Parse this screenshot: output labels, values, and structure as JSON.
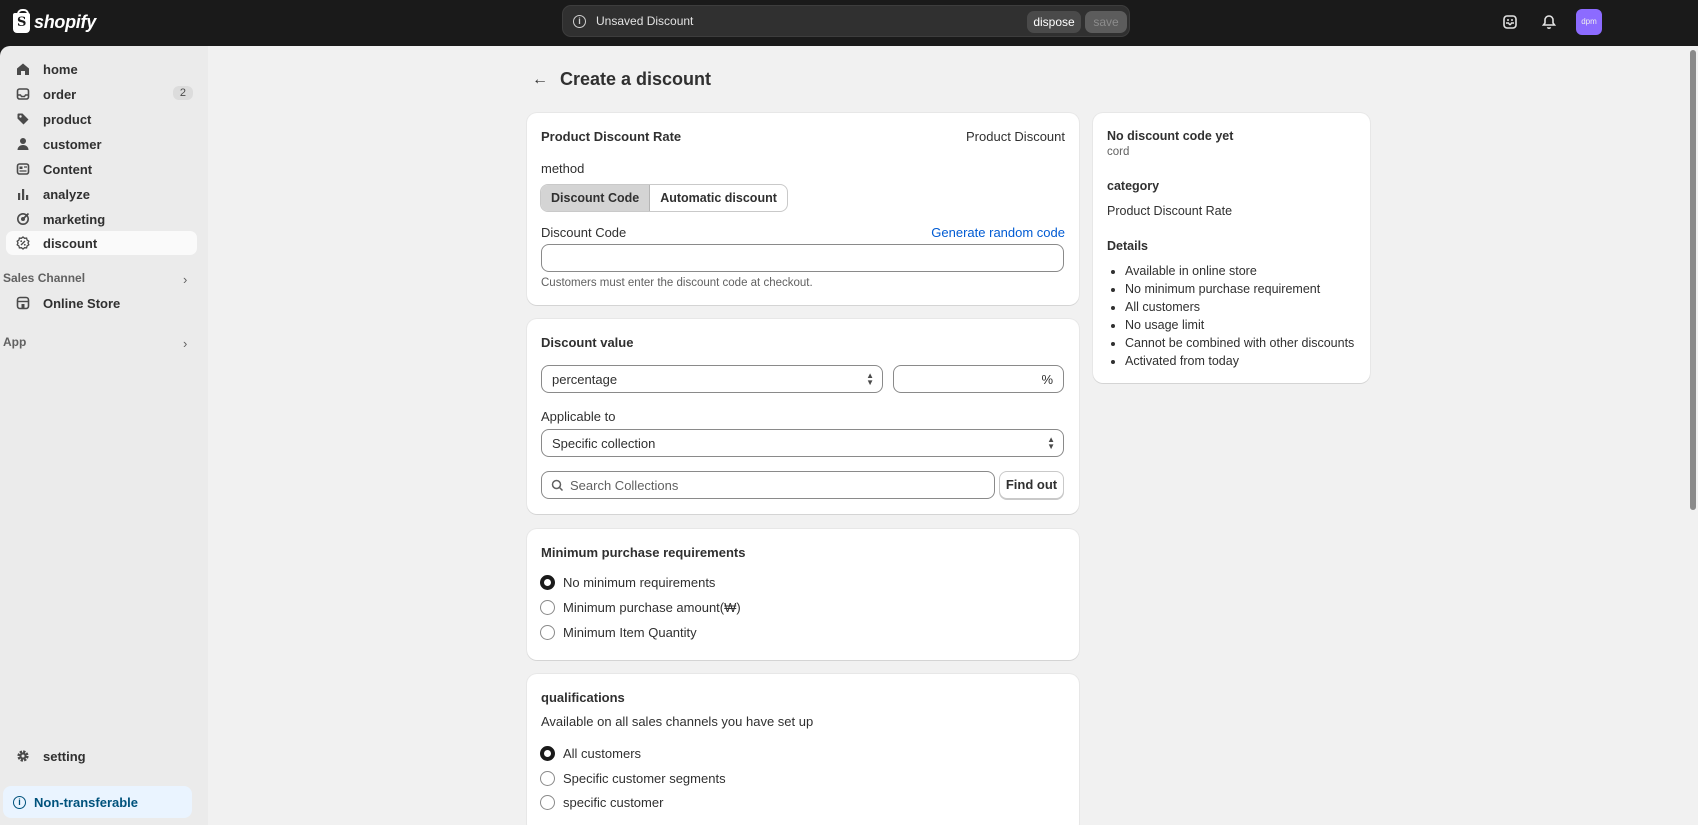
{
  "app": {
    "brand": "shopify"
  },
  "topbar": {
    "unsaved_label": "Unsaved Discount",
    "dispose_label": "dispose",
    "save_label": "save",
    "avatar_initials": "dpm"
  },
  "sidebar": {
    "items": [
      {
        "label": "home",
        "icon": "home-icon"
      },
      {
        "label": "order",
        "icon": "inbox-icon",
        "badge": "2"
      },
      {
        "label": "product",
        "icon": "tag-icon"
      },
      {
        "label": "customer",
        "icon": "person-icon"
      },
      {
        "label": "Content",
        "icon": "content-icon"
      },
      {
        "label": "analyze",
        "icon": "chart-icon"
      },
      {
        "label": "marketing",
        "icon": "target-icon"
      },
      {
        "label": "discount",
        "icon": "discount-icon"
      }
    ],
    "sales_channel_label": "Sales Channel",
    "online_store_label": "Online Store",
    "app_label": "App",
    "setting_label": "setting",
    "non_transferable_label": "Non-transferable"
  },
  "page": {
    "title": "Create a discount"
  },
  "card_code": {
    "title": "Product Discount Rate",
    "type_label": "Product Discount",
    "method_label": "method",
    "method_options": [
      "Discount Code",
      "Automatic discount"
    ],
    "method_selected": "Discount Code",
    "code_label": "Discount Code",
    "generate_link": "Generate random code",
    "code_value": "",
    "help_text": "Customers must enter the discount code at checkout."
  },
  "card_value": {
    "title": "Discount value",
    "type_select": "percentage",
    "amount_value": "",
    "amount_suffix": "%",
    "applicable_label": "Applicable to",
    "applicable_select": "Specific collection",
    "search_placeholder": "Search Collections",
    "find_button": "Find out"
  },
  "card_min": {
    "title": "Minimum purchase requirements",
    "options": [
      "No minimum requirements",
      "Minimum purchase amount(₩)",
      "Minimum Item Quantity"
    ],
    "selected": 0
  },
  "card_qual": {
    "title": "qualifications",
    "subtitle": "Available on all sales channels you have set up",
    "options": [
      "All customers",
      "Specific customer segments",
      "specific customer"
    ],
    "selected": 0
  },
  "summary": {
    "code_title": "No discount code yet",
    "code_sub": "cord",
    "category_label": "category",
    "category_value": "Product Discount Rate",
    "details_label": "Details",
    "details": [
      "Available in online store",
      "No minimum purchase requirement",
      "All customers",
      "No usage limit",
      "Cannot be combined with other discounts",
      "Activated from today"
    ]
  },
  "colors": {
    "topbar": "#1a1a1a",
    "sidebar": "#ebebeb",
    "main": "#f1f1f1",
    "link": "#005bd3",
    "avatar": "#8c6bff"
  }
}
